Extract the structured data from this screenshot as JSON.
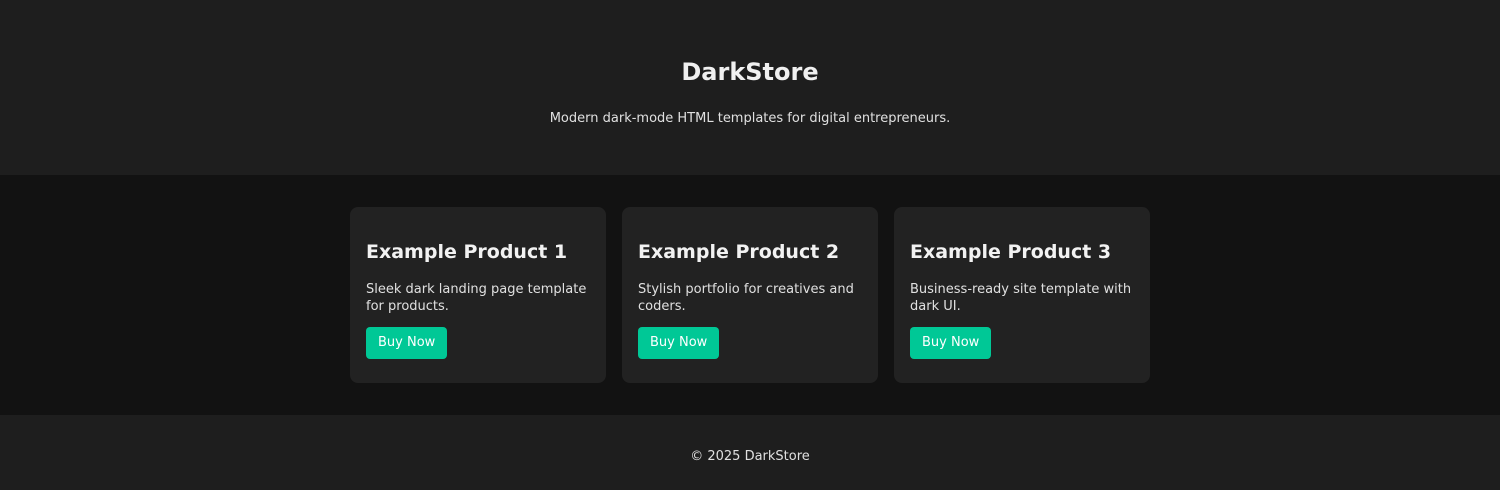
{
  "header": {
    "title": "DarkStore",
    "subtitle": "Modern dark-mode HTML templates for digital entrepreneurs."
  },
  "products": [
    {
      "name": "Example Product 1",
      "description": "Sleek dark landing page template for products.",
      "button_label": "Buy Now"
    },
    {
      "name": "Example Product 2",
      "description": "Stylish portfolio for creatives and coders.",
      "button_label": "Buy Now"
    },
    {
      "name": "Example Product 3",
      "description": "Business-ready site template with dark UI.",
      "button_label": "Buy Now"
    }
  ],
  "footer": {
    "copyright": "© 2025 DarkStore"
  },
  "colors": {
    "accent": "#00c896",
    "header_bg": "#1e1e1e",
    "main_bg": "#121212",
    "card_bg": "#222222"
  }
}
